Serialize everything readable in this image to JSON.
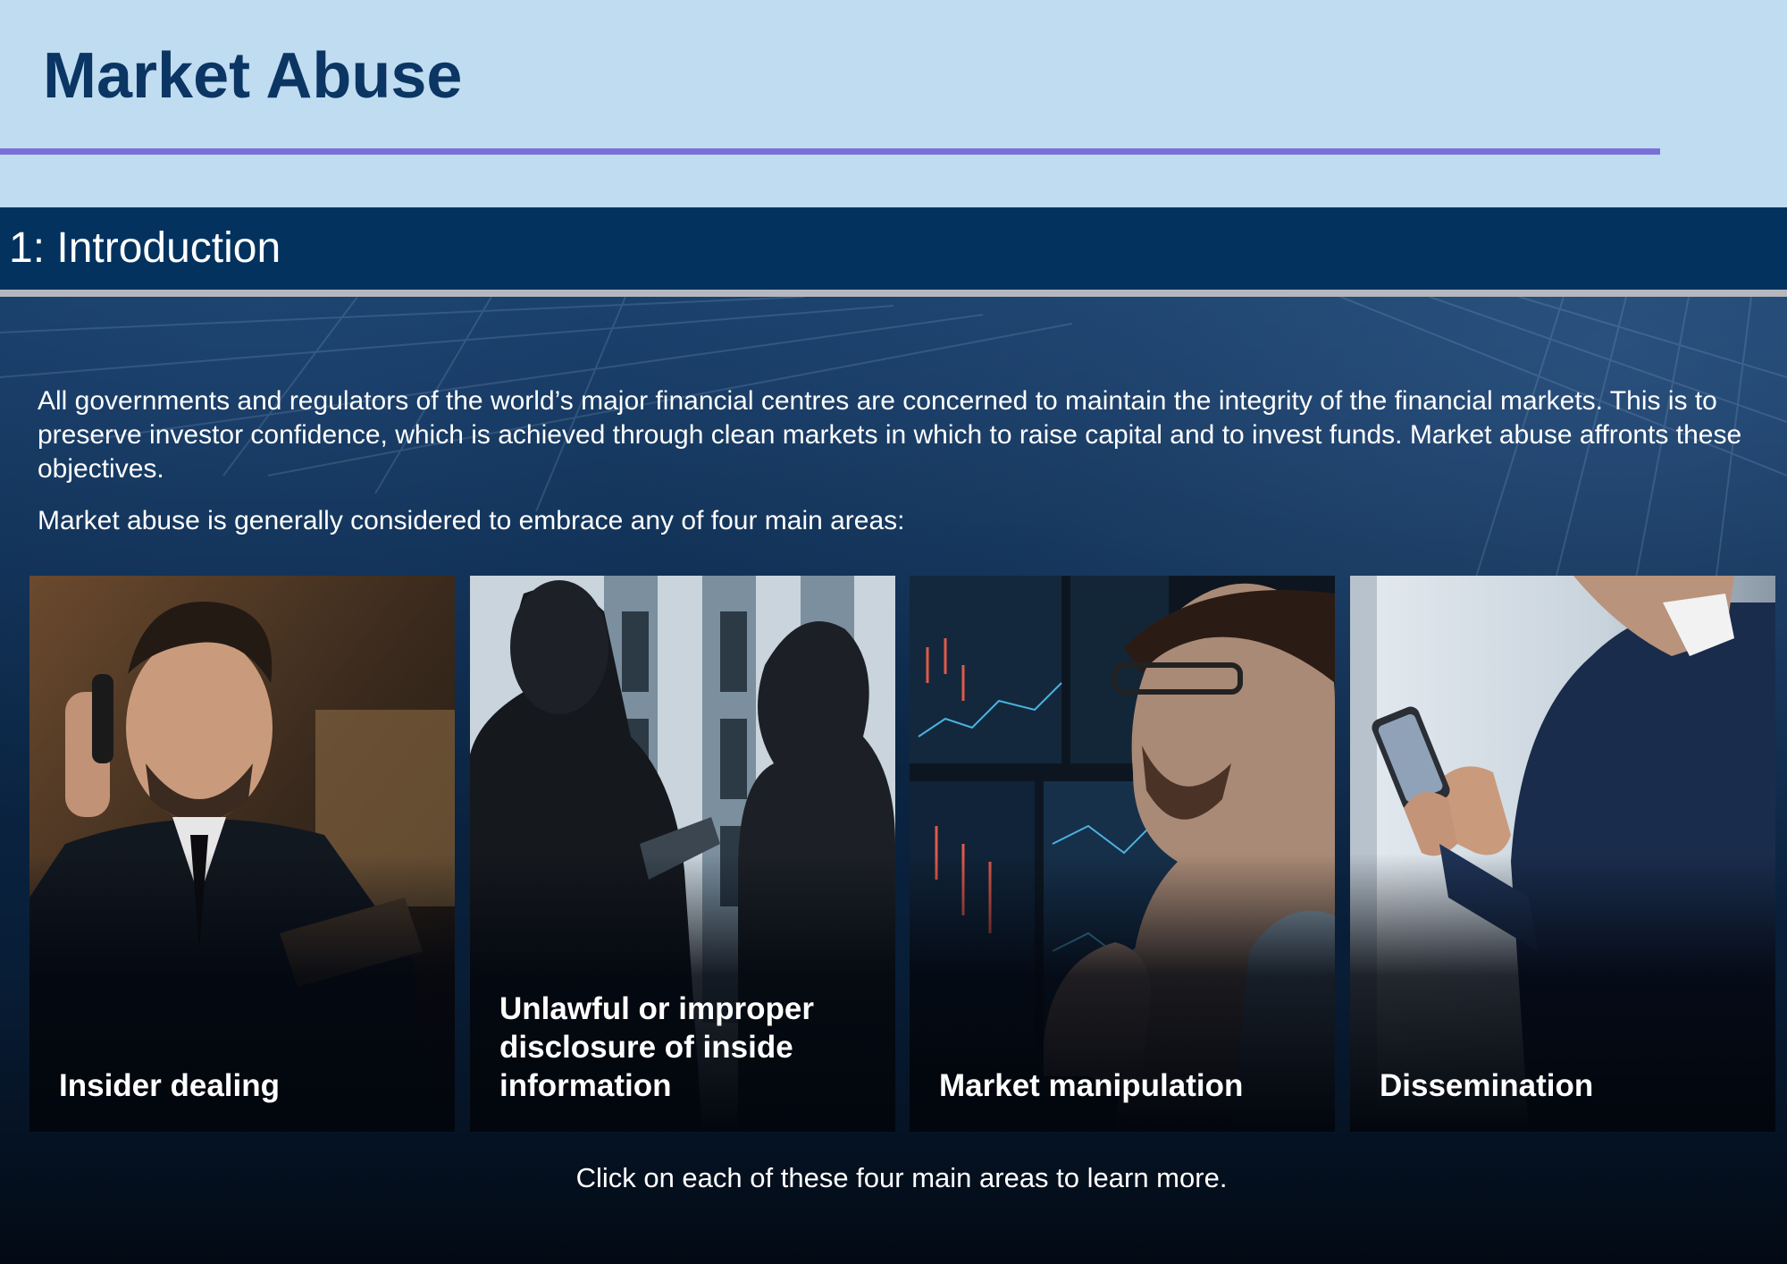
{
  "page": {
    "title": "Market Abuse",
    "accent_colors": {
      "header_background": "#bfdcf0",
      "title_text": "#0b3563",
      "title_rule": "#7a6fd8",
      "section_bar": "#03325e",
      "section_rule": "#b4b8be"
    }
  },
  "section": {
    "title": "1: Introduction"
  },
  "intro": {
    "paragraph_1": "All governments and regulators of the world’s major financial centres are concerned to maintain the integrity of the financial markets. This is to preserve investor confidence, which is achieved through clean markets in which to raise capital and to invest funds. Market abuse affronts these objectives.",
    "paragraph_2": "Market abuse is generally considered to embrace any of four main areas:"
  },
  "cards": [
    {
      "label": "Insider dealing",
      "photo": "man-on-phone-photo"
    },
    {
      "label": "Unlawful or improper disclosure of inside information",
      "photo": "two-people-talking-silhouette-photo"
    },
    {
      "label": "Market manipulation",
      "photo": "trader-at-screens-photo"
    },
    {
      "label": "Dissemination",
      "photo": "man-using-smartphone-photo"
    }
  ],
  "footer": {
    "instruction": "Click on each of these four main areas to learn more."
  }
}
